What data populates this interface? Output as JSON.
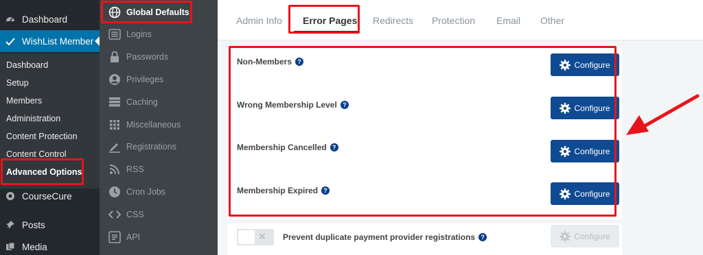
{
  "wp_menu": {
    "dashboard": "Dashboard",
    "wishlist_member": "WishList Member",
    "submenu": [
      "Dashboard",
      "Setup",
      "Members",
      "Administration",
      "Content Protection",
      "Content Control",
      "Advanced Options"
    ],
    "coursecure": "CourseCure",
    "posts": "Posts",
    "media": "Media"
  },
  "plugin_nav": {
    "items": [
      "Global Defaults",
      "Logins",
      "Passwords",
      "Privileges",
      "Caching",
      "Miscellaneous",
      "Registrations",
      "RSS",
      "Cron Jobs",
      "CSS",
      "API"
    ]
  },
  "tabs": [
    "Admin Info",
    "Error Pages",
    "Redirects",
    "Protection",
    "Email",
    "Other"
  ],
  "error_pages": [
    {
      "label": "Non-Members",
      "button": "Configure"
    },
    {
      "label": "Wrong Membership Level",
      "button": "Configure"
    },
    {
      "label": "Membership Cancelled",
      "button": "Configure"
    },
    {
      "label": "Membership Expired",
      "button": "Configure"
    }
  ],
  "duplicate_row": {
    "label": "Prevent duplicate payment provider registrations",
    "button": "Configure",
    "toggle_on": false
  },
  "help_glyph": "?",
  "colors": {
    "accent": "#0073aa",
    "button": "#0f4a92",
    "highlight": "#e8141c"
  }
}
